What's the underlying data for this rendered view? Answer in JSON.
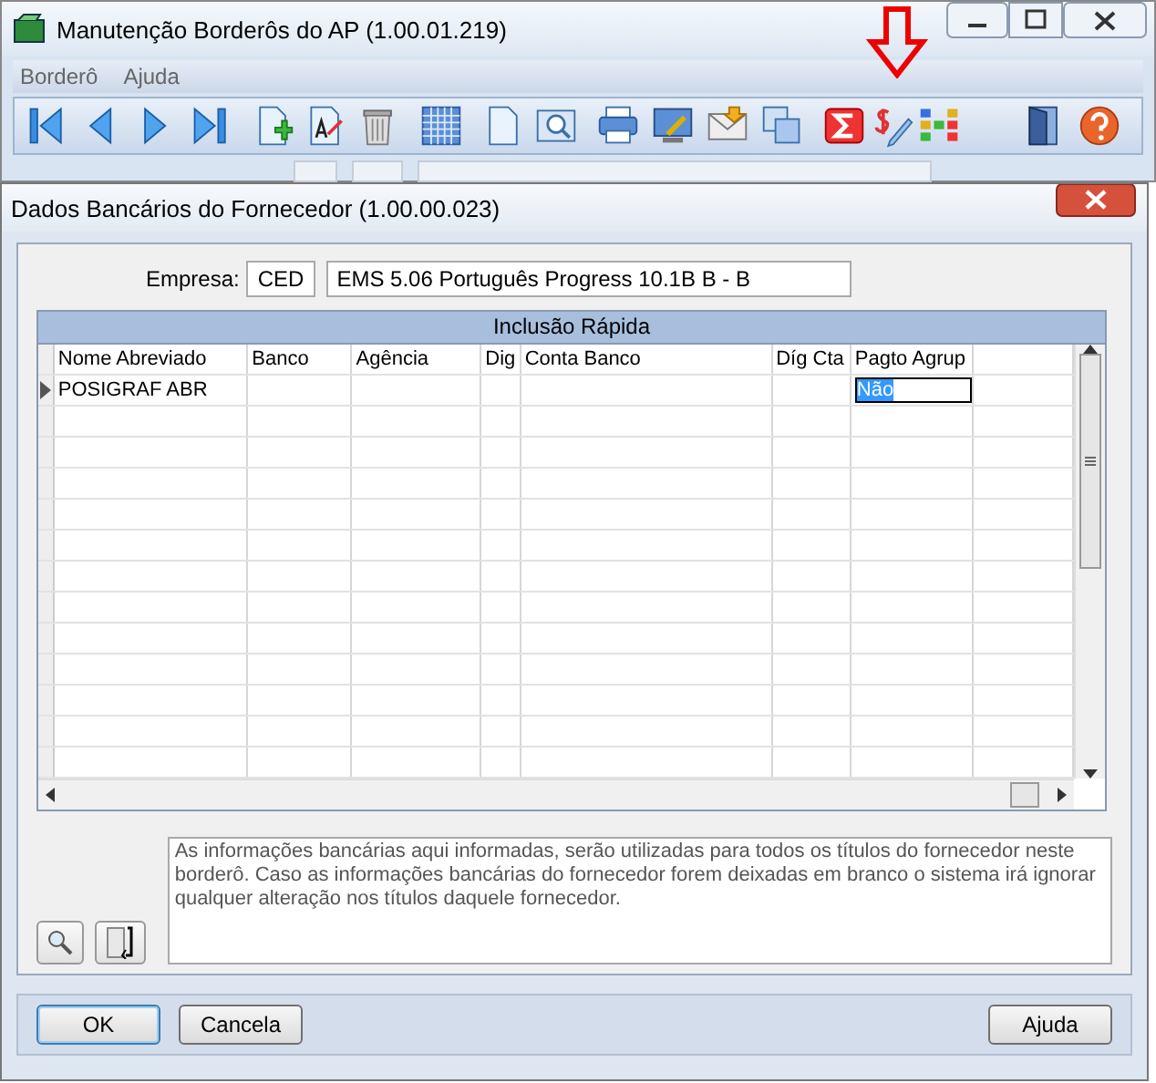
{
  "window": {
    "title": "Manutenção Borderôs do AP (1.00.01.219)"
  },
  "menu": [
    {
      "label": "Borderô"
    },
    {
      "label": "Ajuda"
    }
  ],
  "dialog": {
    "title": "Dados Bancários do Fornecedor (1.00.00.023)",
    "empresa": {
      "label": "Empresa:",
      "code": "CED",
      "name": "EMS 5.06 Português Progress 10.1B B - B"
    },
    "grid": {
      "title": "Inclusão Rápida",
      "columns": [
        "Nome Abreviado",
        "Banco",
        "Agência",
        "Dig",
        "Conta Banco",
        "Díg Cta",
        "Pagto Agrup"
      ],
      "rows": [
        {
          "current": true,
          "cells": [
            {
              "text": "POSIGRAF ABR"
            },
            {},
            {},
            {},
            {},
            {},
            {
              "text": "Não",
              "editing": true
            }
          ]
        }
      ]
    },
    "note": "As informações bancárias aqui informadas, serão utilizadas para todos os títulos do fornecedor neste borderô. Caso as informações bancárias do fornecedor forem deixadas em branco o sistema irá ignorar qualquer alteração nos títulos daquele fornecedor.",
    "buttons": [
      {
        "label": "OK",
        "default": true
      },
      {
        "label": "Cancela",
        "default": false
      },
      {
        "label": "Ajuda",
        "default": false
      }
    ]
  }
}
